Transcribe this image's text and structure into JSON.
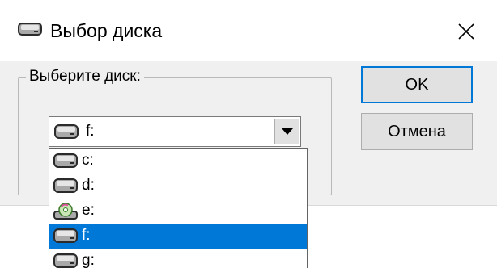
{
  "window": {
    "title": "Выбор диска",
    "title_icon": "drive-icon",
    "close_glyph": "close-icon"
  },
  "group": {
    "legend": "Выберите диск:"
  },
  "combo": {
    "selected": "f:",
    "icon": "drive-icon",
    "arrow_icon": "chevron-down-icon"
  },
  "dropdown": {
    "items": [
      {
        "label": "c:",
        "icon": "drive-icon"
      },
      {
        "label": "d:",
        "icon": "drive-icon"
      },
      {
        "label": "e:",
        "icon": "cd-drive-icon"
      },
      {
        "label": "f:",
        "icon": "drive-icon",
        "selected": true
      },
      {
        "label": "g:",
        "icon": "drive-icon"
      }
    ]
  },
  "buttons": {
    "ok_label": "OK",
    "cancel_label": "Отмена"
  },
  "colors": {
    "selection": "#0078d7",
    "button_face": "#e1e1e1",
    "dialog_bg": "#f0f0f0"
  }
}
